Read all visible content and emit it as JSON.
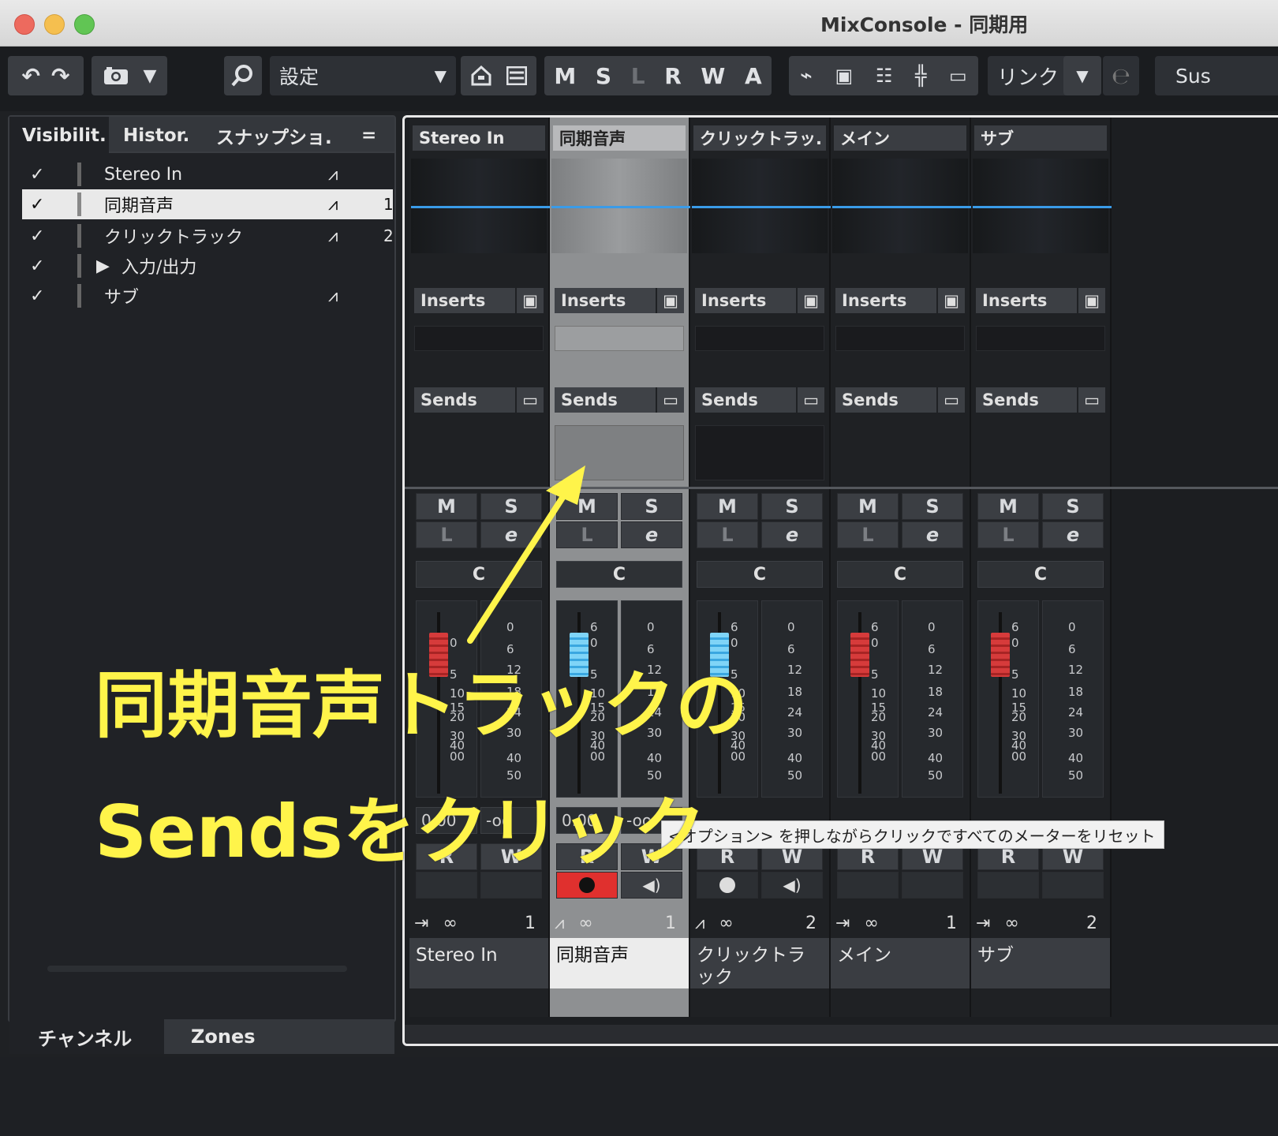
{
  "window": {
    "title": "MixConsole - 同期用"
  },
  "toolbar": {
    "preset": "設定",
    "msl": [
      "M",
      "S",
      "L",
      "R",
      "W",
      "A"
    ],
    "link": "リンク",
    "sus": "Sus"
  },
  "left_panel": {
    "tabs": [
      "Visibilit.",
      "Histor.",
      "スナップショ.",
      "="
    ],
    "rows": [
      {
        "check": "✓",
        "label": "Stereo In",
        "num": ""
      },
      {
        "check": "✓",
        "label": "同期音声",
        "num": "1"
      },
      {
        "check": "✓",
        "label": "クリックトラック",
        "num": "2"
      },
      {
        "check": "✓",
        "label": "入力/出力",
        "num": ""
      },
      {
        "check": "✓",
        "label": "サブ",
        "num": ""
      }
    ],
    "bottom_tabs": [
      "チャンネル",
      "Zones"
    ]
  },
  "channels": [
    {
      "header": "Stereo In",
      "name": "Stereo In",
      "num": "1",
      "selected": false
    },
    {
      "header": "同期音声",
      "name": "同期音声",
      "num": "1",
      "selected": true
    },
    {
      "header": "クリックトラッ.",
      "name": "クリックトラック",
      "num": "2",
      "selected": false
    },
    {
      "header": "メイン",
      "name": "メイン",
      "num": "1",
      "selected": false
    },
    {
      "header": "サブ",
      "name": "サブ",
      "num": "2",
      "selected": false
    }
  ],
  "labels": {
    "inserts": "Inserts",
    "sends": "Sends",
    "m": "M",
    "s": "S",
    "l": "L",
    "e": "e",
    "pan": "C",
    "r": "R",
    "w": "W",
    "fader_value": "0.00",
    "meter_value": "-oo"
  },
  "fader_scale": [
    "6",
    "0",
    "5",
    "10",
    "15",
    "20",
    "30",
    "40",
    "00"
  ],
  "meter_scale": [
    "0",
    "6",
    "12",
    "18",
    "24",
    "30",
    "40",
    "50"
  ],
  "tooltip": "<オプション> を押しながらクリックですべてのメーターをリセット",
  "annotation": {
    "line1": "同期音声トラックの",
    "line2": "Sendsをクリック"
  },
  "colors": {
    "accent_blue": "#3a9be8",
    "annotation": "#fff44a",
    "record": "#e0302e"
  }
}
